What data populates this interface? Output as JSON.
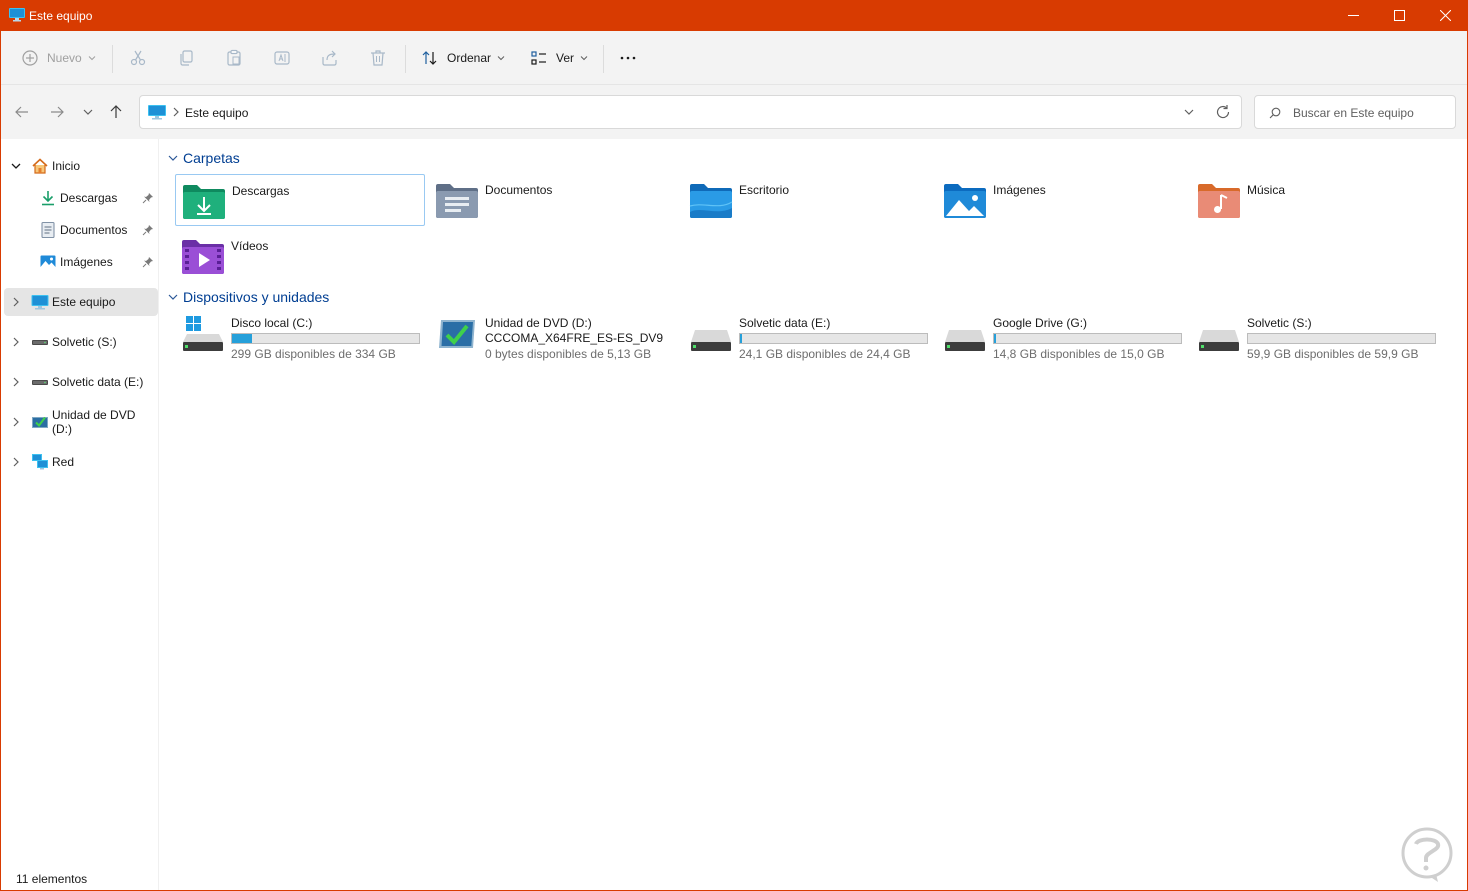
{
  "window": {
    "title": "Este equipo",
    "accent_color": "#d83b01",
    "controls": [
      "minimize",
      "maximize",
      "close"
    ]
  },
  "command_bar": {
    "new_label": "Nuevo",
    "sort_label": "Ordenar",
    "view_label": "Ver",
    "icons": [
      "cut-icon",
      "copy-icon",
      "paste-icon",
      "rename-icon",
      "share-icon",
      "delete-icon",
      "more-icon"
    ]
  },
  "address": {
    "breadcrumb": "Este equipo",
    "search_placeholder": "Buscar en Este equipo"
  },
  "sidebar": {
    "items": [
      {
        "label": "Inicio",
        "icon": "home-icon",
        "expanded": true
      },
      {
        "label": "Descargas",
        "icon": "downloads-icon",
        "pinned": true
      },
      {
        "label": "Documentos",
        "icon": "documents-icon",
        "pinned": true
      },
      {
        "label": "Imágenes",
        "icon": "pictures-icon",
        "pinned": true
      },
      {
        "label": "Este equipo",
        "icon": "pc-icon",
        "selected": true
      },
      {
        "label": "Solvetic (S:)",
        "icon": "drive-icon"
      },
      {
        "label": "Solvetic data (E:)",
        "icon": "drive-icon"
      },
      {
        "label": "Unidad de DVD (D:)",
        "icon": "dvd-icon"
      },
      {
        "label": "Red",
        "icon": "network-icon"
      }
    ]
  },
  "main": {
    "folders_header": "Carpetas",
    "folders": [
      {
        "name": "Descargas",
        "icon": "downloads-folder-icon",
        "selected": true
      },
      {
        "name": "Documentos",
        "icon": "documents-folder-icon"
      },
      {
        "name": "Escritorio",
        "icon": "desktop-folder-icon"
      },
      {
        "name": "Imágenes",
        "icon": "pictures-folder-icon"
      },
      {
        "name": "Música",
        "icon": "music-folder-icon"
      },
      {
        "name": "Vídeos",
        "icon": "videos-folder-icon"
      }
    ],
    "devices_header": "Dispositivos y unidades",
    "drives": [
      {
        "name": "Disco local (C:)",
        "free": "299 GB disponibles de 334 GB",
        "used_fraction": 0.105,
        "icon": "windows-drive-icon"
      },
      {
        "name": "Unidad de DVD (D:)",
        "label2": "CCCOMA_X64FRE_ES-ES_DV9",
        "free": "0 bytes disponibles de 5,13 GB",
        "icon": "dvd-drive-icon"
      },
      {
        "name": "Solvetic data (E:)",
        "free": "24,1 GB disponibles de 24,4 GB",
        "used_fraction": 0.012,
        "icon": "hdd-icon"
      },
      {
        "name": "Google Drive (G:)",
        "free": "14,8 GB disponibles de 15,0 GB",
        "used_fraction": 0.013,
        "icon": "hdd-icon"
      },
      {
        "name": "Solvetic (S:)",
        "free": "59,9 GB disponibles de 59,9 GB",
        "used_fraction": 0.0,
        "icon": "hdd-icon"
      }
    ]
  },
  "status": {
    "count": "11 elementos"
  }
}
